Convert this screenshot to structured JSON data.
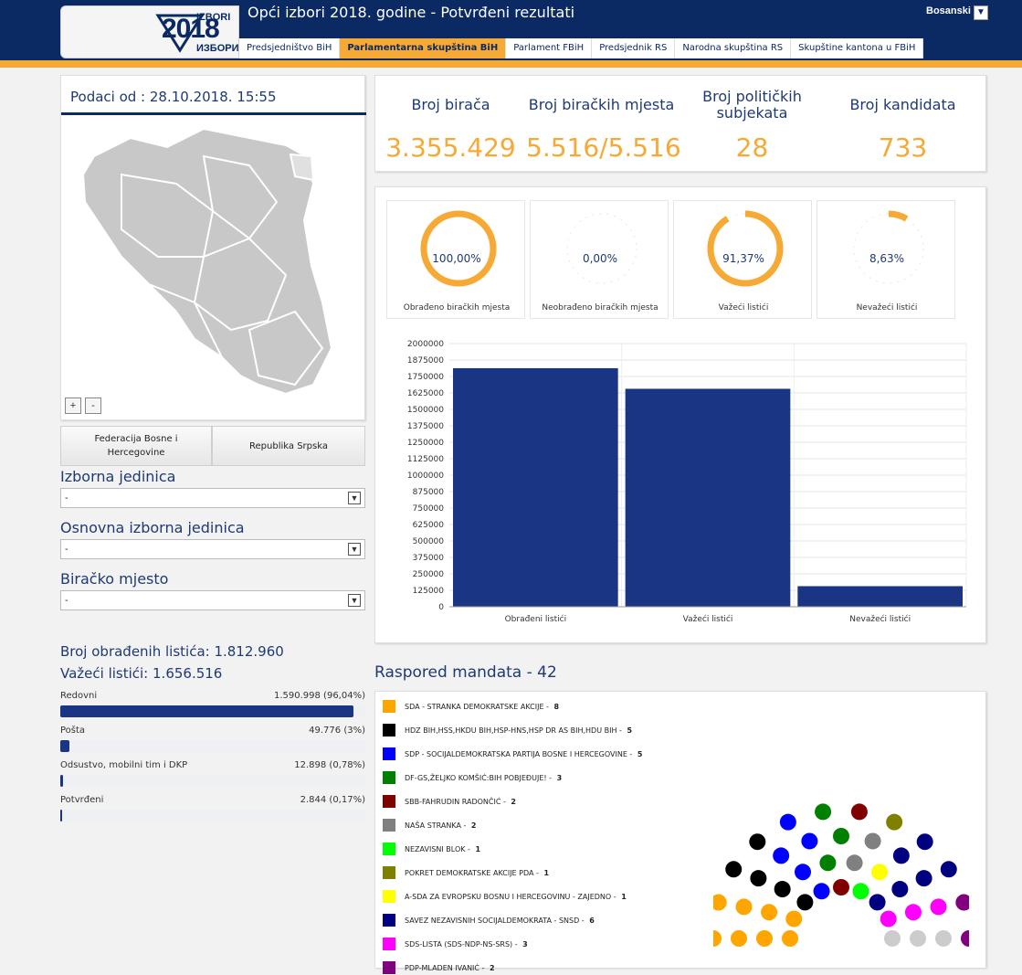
{
  "header": {
    "logo_top": "IZBORI",
    "logo_year": "2018",
    "logo_bottom": "ИЗБОРИ",
    "title": "Opći izbori 2018. godine - Potvrđeni rezultati",
    "language": "Bosanski",
    "tabs": [
      {
        "label": "Predsjedništvo BiH",
        "active": false
      },
      {
        "label": "Parlamentarna skupština BiH",
        "active": true
      },
      {
        "label": "Parlament FBiH",
        "active": false
      },
      {
        "label": "Predsjednik RS",
        "active": false
      },
      {
        "label": "Narodna skupština RS",
        "active": false
      },
      {
        "label": "Skupštine kantona u FBiH",
        "active": false
      }
    ]
  },
  "left": {
    "date_label": "Podaci od : 28.10.2018. 15:55",
    "zoom_in": "+",
    "zoom_out": "-",
    "entity_buttons": [
      "Federacija Bosne i Hercegovine",
      "Republika Srpska"
    ],
    "selects": [
      {
        "label": "Izborna jedinica",
        "value": "-"
      },
      {
        "label": "Osnovna izborna jedinica",
        "value": "-"
      },
      {
        "label": "Biračko mjesto",
        "value": "-"
      }
    ],
    "processed_ballots": "Broj obrađenih listića: 1.812.960",
    "valid_ballots": "Važeći listići: 1.656.516",
    "breakdown": [
      {
        "label": "Redovni",
        "value": "1.590.998 (96,04%)",
        "pct": 96.04
      },
      {
        "label": "Pošta",
        "value": "49.776 (3%)",
        "pct": 3
      },
      {
        "label": "Odsustvo, mobilni tim i DKP",
        "value": "12.898 (0,78%)",
        "pct": 0.78
      },
      {
        "label": "Potvrđeni",
        "value": "2.844 (0,17%)",
        "pct": 0.17
      }
    ]
  },
  "stats": [
    {
      "label": "Broj birača",
      "value": "3.355.429"
    },
    {
      "label": "Broj biračkih mjesta",
      "value": "5.516/5.516"
    },
    {
      "label": "Broj političkih subjekata",
      "value": "28"
    },
    {
      "label": "Broj kandidata",
      "value": "733"
    }
  ],
  "rings": [
    {
      "value": "100,00%",
      "pct": 100,
      "caption": "Obrađeno biračkih mjesta"
    },
    {
      "value": "0,00%",
      "pct": 0,
      "caption": "Neobrađeno biračkih mjesta"
    },
    {
      "value": "91,37%",
      "pct": 91.37,
      "caption": "Važeći listići"
    },
    {
      "value": "8,63%",
      "pct": 8.63,
      "caption": "Nevažeći listići"
    }
  ],
  "chart_data": {
    "type": "bar",
    "categories": [
      "Obrađeni listići",
      "Važeći listići",
      "Nevažeći listići"
    ],
    "values": [
      1812960,
      1656516,
      156444
    ],
    "ylim": [
      0,
      2000000
    ],
    "yticks": [
      0,
      125000,
      250000,
      375000,
      500000,
      625000,
      750000,
      875000,
      1000000,
      1125000,
      1250000,
      1375000,
      1500000,
      1625000,
      1750000,
      1875000,
      2000000
    ],
    "color": "#1b3585",
    "grid": true
  },
  "mandata": {
    "title": "Raspored mandata - 42",
    "parties": [
      {
        "name": "SDA - STRANKA DEMOKRATSKE AKCIJE",
        "seats": "8",
        "color": "#ffa500"
      },
      {
        "name": "HDZ BIH,HSS,HKDU BIH,HSP-HNS,HSP DR AS BIH,HDU BIH",
        "seats": "5",
        "color": "#000000"
      },
      {
        "name": "SDP - SOCIJALDEMOKRATSKA PARTIJA BOSNE I HERCEGOVINE",
        "seats": "5",
        "color": "#0000ff"
      },
      {
        "name": "DF-GS,ŽELJKO KOMŠIĆ:BIH POBJEĐUJE!",
        "seats": "3",
        "color": "#008000"
      },
      {
        "name": "SBB-FAHRUDIN RADONČIĆ",
        "seats": "2",
        "color": "#800000"
      },
      {
        "name": "NAŠA STRANKA",
        "seats": "2",
        "color": "#808080"
      },
      {
        "name": "NEZAVISNI BLOK",
        "seats": "1",
        "color": "#00ff00"
      },
      {
        "name": "POKRET DEMOKRATSKE AKCIJE PDA",
        "seats": "1",
        "color": "#808000"
      },
      {
        "name": "A-SDA ZA EVROPSKU BOSNU I HERCEGOVINU - ZAJEDNO",
        "seats": "1",
        "color": "#ffff00"
      },
      {
        "name": "SAVEZ NEZAVISNIH SOCIJALDEMOKRATA - SNSD",
        "seats": "6",
        "color": "#000080"
      },
      {
        "name": "SDS-LISTA (SDS-NDP-NS-SRS)",
        "seats": "3",
        "color": "#ff00ff"
      },
      {
        "name": "PDP-MLADEN IVANIĆ",
        "seats": "2",
        "color": "#800080"
      }
    ]
  }
}
